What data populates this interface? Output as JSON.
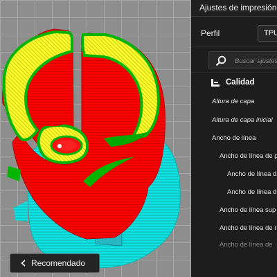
{
  "viewport": {
    "model_name": "3d-print-preview"
  },
  "panel": {
    "title": "Ajustes de impresión",
    "profile_label": "Perfil",
    "profile_value": "TPU",
    "search_placeholder": "Buscar ajustes",
    "category_label": "Calidad",
    "settings": [
      "Altura de capa",
      "Altura de capa inicial",
      "Ancho de línea",
      "Ancho de línea de p",
      "Ancho de línea d",
      "Ancho de línea d",
      "Ancho de línea sup",
      "Ancho de línea de r",
      "Ancho de línea de"
    ],
    "recommended_label": "Recomendado"
  },
  "colors": {
    "wall_red": "#ff0000",
    "skin_yellow": "#ffff00",
    "inner_green": "#00c400",
    "support_cyan": "#00e5e5",
    "panel_bg": "#1d1d1d"
  }
}
